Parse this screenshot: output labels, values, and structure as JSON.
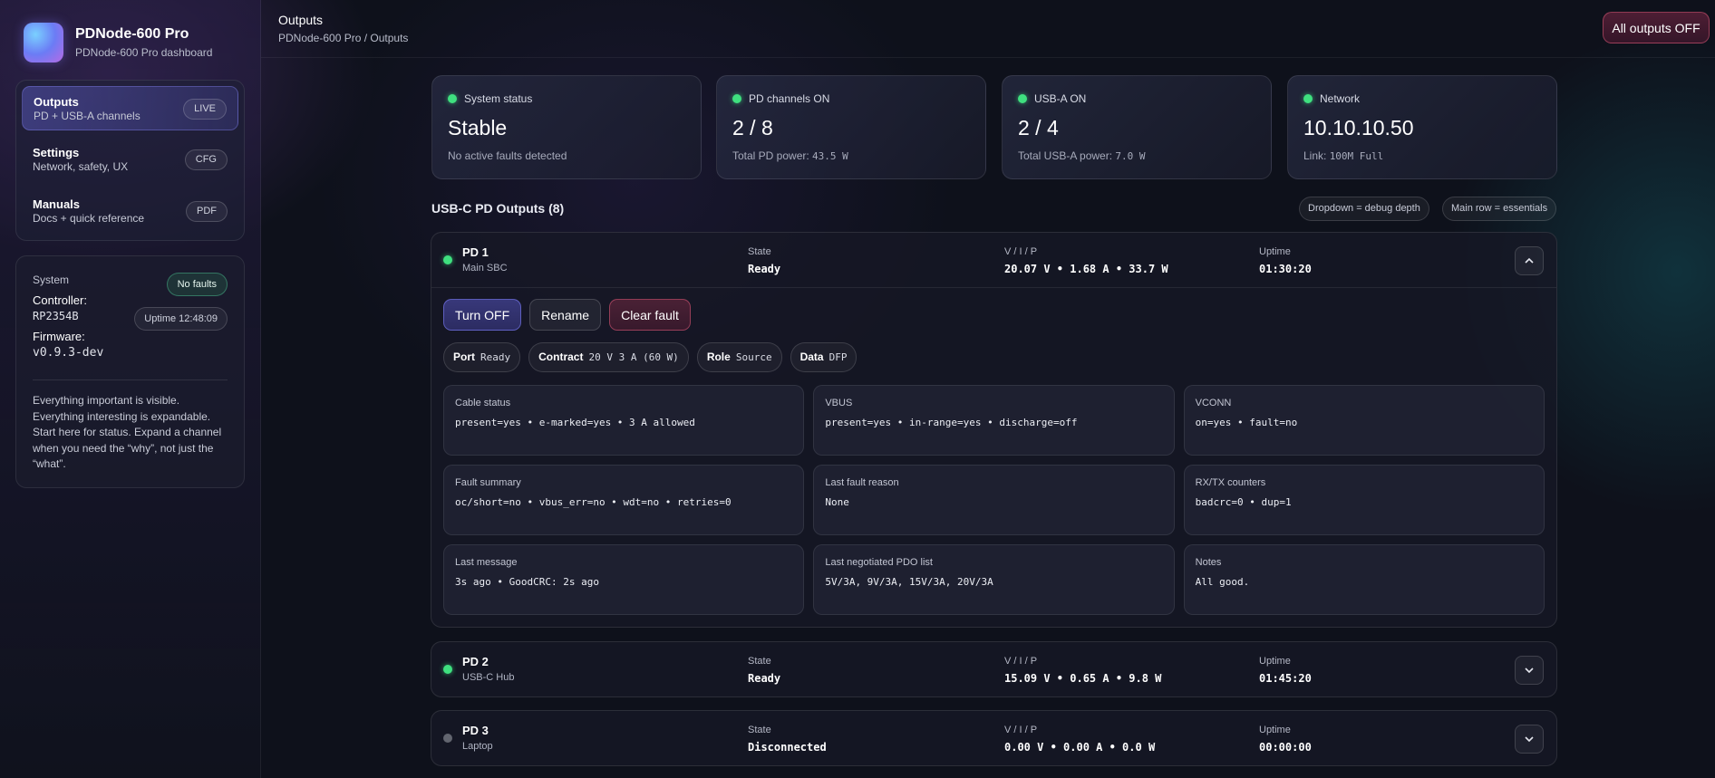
{
  "brand": {
    "title": "PDNode-600 Pro",
    "subtitle": "PDNode-600 Pro dashboard"
  },
  "nav": [
    {
      "title": "Outputs",
      "sub": "PD + USB-A channels",
      "badge": "LIVE"
    },
    {
      "title": "Settings",
      "sub": "Network, safety, UX",
      "badge": "CFG"
    },
    {
      "title": "Manuals",
      "sub": "Docs + quick reference",
      "badge": "PDF"
    }
  ],
  "system": {
    "label": "System",
    "status_badge": "No faults",
    "controller_key": "Controller:",
    "controller_val": "RP2354B",
    "uptime_badge": "Uptime 12:48:09",
    "firmware_key": "Firmware:",
    "firmware_val": "v0.9.3-dev",
    "note": "Everything important is visible. Everything interesting is expandable. Start here for status. Expand a channel when you need the “why”, not just the “what”."
  },
  "header": {
    "title": "Outputs",
    "breadcrumb": "PDNode-600 Pro / Outputs",
    "all_off": "All outputs OFF"
  },
  "stats": [
    {
      "label": "System status",
      "value": "Stable",
      "foot_text": "No active faults detected",
      "foot_mono": ""
    },
    {
      "label": "PD channels ON",
      "value": "2 / 8",
      "foot_text": "Total PD power: ",
      "foot_mono": "43.5 W"
    },
    {
      "label": "USB-A ON",
      "value": "2 / 4",
      "foot_text": "Total USB-A power: ",
      "foot_mono": "7.0 W"
    },
    {
      "label": "Network",
      "value": "10.10.10.50",
      "foot_text": "Link: ",
      "foot_mono": "100M Full"
    }
  ],
  "section": {
    "title": "USB-C PD Outputs (8)",
    "hint1": "Dropdown = debug depth",
    "hint2": "Main row = essentials"
  },
  "columns": {
    "state": "State",
    "vip": "V / I / P",
    "uptime": "Uptime"
  },
  "channels": [
    {
      "name": "PD 1",
      "sub": "Main SBC",
      "state": "Ready",
      "vip": "20.07 V • 1.68 A • 33.7 W",
      "uptime": "01:30:20",
      "chevron": "^"
    },
    {
      "name": "PD 2",
      "sub": "USB-C Hub",
      "state": "Ready",
      "vip": "15.09 V • 0.65 A • 9.8 W",
      "uptime": "01:45:20",
      "chevron": "⌄"
    },
    {
      "name": "PD 3",
      "sub": "Laptop",
      "state": "Disconnected",
      "vip": "0.00 V • 0.00 A • 0.0 W",
      "uptime": "00:00:00",
      "chevron": "⌄"
    }
  ],
  "detail": {
    "buttons": {
      "turn_off": "Turn OFF",
      "rename": "Rename",
      "clear_fault": "Clear fault"
    },
    "chips": [
      {
        "key": "Port",
        "val": "Ready"
      },
      {
        "key": "Contract",
        "val": "20 V 3 A (60 W)"
      },
      {
        "key": "Role",
        "val": "Source"
      },
      {
        "key": "Data",
        "val": "DFP"
      }
    ],
    "cards": [
      {
        "label": "Cable status",
        "value": "present=yes • e-marked=yes • 3 A allowed"
      },
      {
        "label": "VBUS",
        "value": "present=yes • in-range=yes • discharge=off"
      },
      {
        "label": "VCONN",
        "value": "on=yes • fault=no"
      },
      {
        "label": "Fault summary",
        "value": "oc/short=no • vbus_err=no • wdt=no • retries=0"
      },
      {
        "label": "Last fault reason",
        "value": "None"
      },
      {
        "label": "RX/TX counters",
        "value": "badcrc=0 • dup=1"
      },
      {
        "label": "Last message",
        "value": "3s ago • GoodCRC: 2s ago"
      },
      {
        "label": "Last negotiated PDO list",
        "value": "5V/3A, 9V/3A, 15V/3A, 20V/3A"
      },
      {
        "label": "Notes",
        "value": "All good."
      }
    ]
  },
  "colors": {
    "ok": "#3fe07f",
    "off": "#62656f",
    "accent": "#6b6bd6",
    "danger": "#c04a6a"
  }
}
